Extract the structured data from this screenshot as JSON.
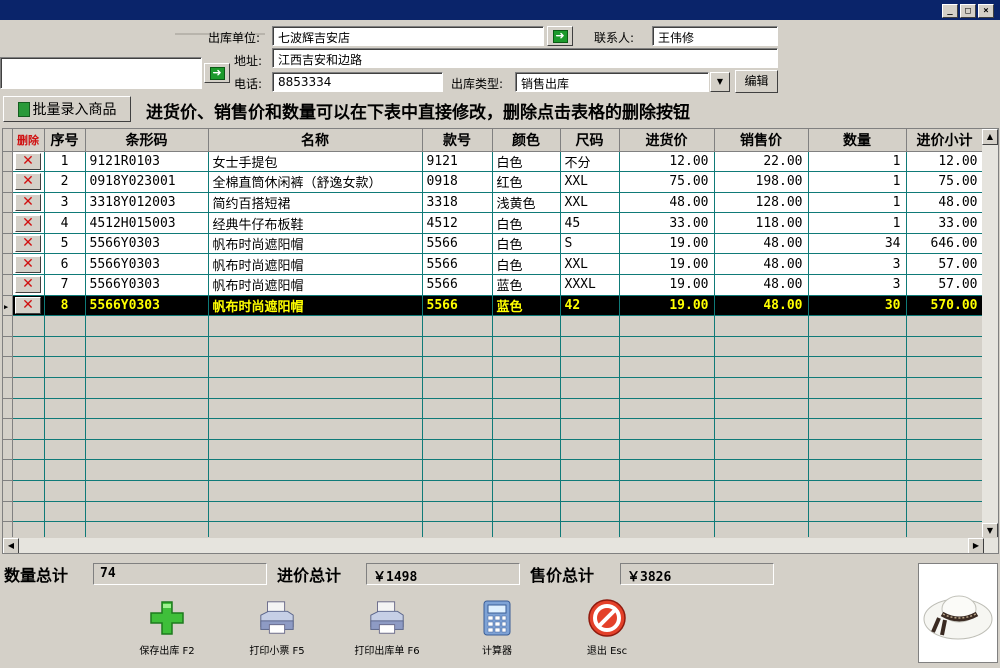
{
  "window": {
    "min": "_",
    "max": "□",
    "close": "×"
  },
  "form": {
    "outlet_label": "出库单位:",
    "outlet_value": "七波辉吉安店",
    "contact_label": "联系人:",
    "contact_value": "王伟修",
    "address_label": "地址:",
    "address_value": "江西吉安和边路",
    "phone_label": "电话:",
    "phone_value": "8853334",
    "type_label": "出库类型:",
    "type_value": "销售出库",
    "edit_button": "编辑",
    "left_input_value": ""
  },
  "toolbar": {
    "batch_button": "批量录入商品",
    "hint": "进货价、销售价和数量可以在下表中直接修改，删除点击表格的删除按钮"
  },
  "grid": {
    "columns": [
      "删除",
      "序号",
      "条形码",
      "名称",
      "款号",
      "颜色",
      "尺码",
      "进货价",
      "销售价",
      "数量",
      "进价小计"
    ],
    "delete_glyph": "✕",
    "rows": [
      {
        "seq": "1",
        "barcode": "9121R0103",
        "name": "女士手提包",
        "style": "9121",
        "color": "白色",
        "size": "不分",
        "cost": "12.00",
        "price": "22.00",
        "qty": "1",
        "subtotal": "12.00"
      },
      {
        "seq": "2",
        "barcode": "0918Y023001",
        "name": "全棉直筒休闲裤（舒逸女款）",
        "style": "0918",
        "color": "红色",
        "size": "XXL",
        "cost": "75.00",
        "price": "198.00",
        "qty": "1",
        "subtotal": "75.00"
      },
      {
        "seq": "3",
        "barcode": "3318Y012003",
        "name": "简约百搭短裙",
        "style": "3318",
        "color": "浅黄色",
        "size": "XXL",
        "cost": "48.00",
        "price": "128.00",
        "qty": "1",
        "subtotal": "48.00"
      },
      {
        "seq": "4",
        "barcode": "4512H015003",
        "name": "经典牛仔布板鞋",
        "style": "4512",
        "color": "白色",
        "size": "45",
        "cost": "33.00",
        "price": "118.00",
        "qty": "1",
        "subtotal": "33.00"
      },
      {
        "seq": "5",
        "barcode": "5566Y0303",
        "name": "帆布时尚遮阳帽",
        "style": "5566",
        "color": "白色",
        "size": "S",
        "cost": "19.00",
        "price": "48.00",
        "qty": "34",
        "subtotal": "646.00"
      },
      {
        "seq": "6",
        "barcode": "5566Y0303",
        "name": "帆布时尚遮阳帽",
        "style": "5566",
        "color": "白色",
        "size": "XXL",
        "cost": "19.00",
        "price": "48.00",
        "qty": "3",
        "subtotal": "57.00"
      },
      {
        "seq": "7",
        "barcode": "5566Y0303",
        "name": "帆布时尚遮阳帽",
        "style": "5566",
        "color": "蓝色",
        "size": "XXXL",
        "cost": "19.00",
        "price": "48.00",
        "qty": "3",
        "subtotal": "57.00"
      },
      {
        "seq": "8",
        "barcode": "5566Y0303",
        "name": "帆布时尚遮阳帽",
        "style": "5566",
        "color": "蓝色",
        "size": "42",
        "cost": "19.00",
        "price": "48.00",
        "qty": "30",
        "subtotal": "570.00"
      }
    ],
    "selected_row": "8"
  },
  "totals": {
    "qty_label": "数量总计",
    "qty_value": "74",
    "cost_label": "进价总计",
    "cost_value": "￥1498",
    "price_label": "售价总计",
    "price_value": "￥3826"
  },
  "actions": {
    "save": "保存出库 F2",
    "print_receipt": "打印小票 F5",
    "print_slip": "打印出库单 F6",
    "calculator": "计算器",
    "exit": "退出 Esc"
  },
  "colors": {
    "title_bar": "#0a246a",
    "selected_row_bg": "#000000",
    "selected_row_text": "#ffff00",
    "grid_line": "#0f7a78",
    "delete_mark": "#d01010"
  }
}
